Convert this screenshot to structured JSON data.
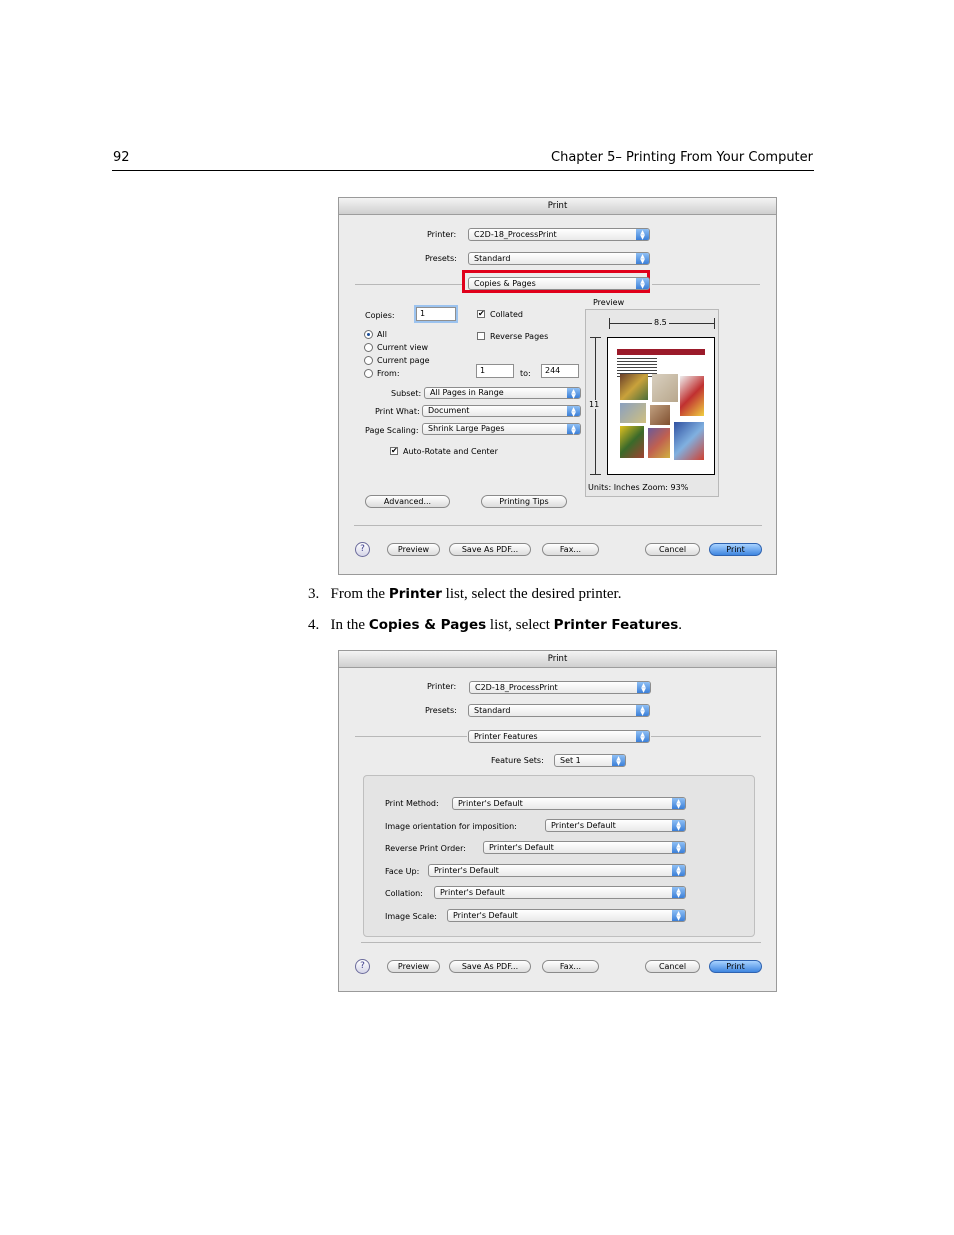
{
  "header": {
    "page_number": "92",
    "chapter_title": "Chapter 5– Printing From Your Computer"
  },
  "dialog1": {
    "title": "Print",
    "printer_label": "Printer:",
    "printer_value": "C2D-18_ProcessPrint",
    "presets_label": "Presets:",
    "presets_value": "Standard",
    "panel_value": "Copies & Pages",
    "copies_label": "Copies:",
    "copies_value": "1",
    "collated_label": "Collated",
    "reverse_label": "Reverse Pages",
    "pages_options": [
      "All",
      "Current view",
      "Current page",
      "From:"
    ],
    "from_value": "1",
    "to_label": "to:",
    "to_value": "244",
    "subset_label": "Subset:",
    "subset_value": "All Pages in Range",
    "printwhat_label": "Print What:",
    "printwhat_value": "Document",
    "scaling_label": "Page Scaling:",
    "scaling_value": "Shrink Large Pages",
    "autorotate_label": "Auto-Rotate and Center",
    "preview_label": "Preview",
    "width_label": "8.5",
    "height_label": "11",
    "units_text": "Units: Inches  Zoom:  93%",
    "advanced_button": "Advanced...",
    "tips_button": "Printing Tips",
    "help_glyph": "?",
    "preview_button": "Preview",
    "save_pdf_button": "Save As PDF...",
    "fax_button": "Fax...",
    "cancel_button": "Cancel",
    "print_button": "Print",
    "highlight_color": "#e0001b"
  },
  "steps": [
    {
      "num": "3.",
      "pre": "From the ",
      "b1": "Printer",
      "mid": " list, select the desired printer.",
      "b2": "",
      "post": ""
    },
    {
      "num": "4.",
      "pre": "In the ",
      "b1": "Copies & Pages",
      "mid": " list, select ",
      "b2": "Printer Features",
      "post": "."
    }
  ],
  "dialog2": {
    "title": "Print",
    "printer_label": "Printer:",
    "printer_value": "C2D-18_ProcessPrint",
    "presets_label": "Presets:",
    "presets_value": "Standard",
    "panel_value": "Printer Features",
    "feature_sets_label": "Feature Sets:",
    "feature_sets_value": "Set 1",
    "features": [
      {
        "label": "Print Method:",
        "value": "Printer's Default"
      },
      {
        "label": "Image orientation for imposition:",
        "value": "Printer's Default"
      },
      {
        "label": "Reverse Print Order:",
        "value": "Printer's Default"
      },
      {
        "label": "Face Up:",
        "value": "Printer's Default"
      },
      {
        "label": "Collation:",
        "value": "Printer's Default"
      },
      {
        "label": "Image Scale:",
        "value": "Printer's Default"
      }
    ],
    "help_glyph": "?",
    "preview_button": "Preview",
    "save_pdf_button": "Save As PDF...",
    "fax_button": "Fax...",
    "cancel_button": "Cancel",
    "print_button": "Print"
  }
}
